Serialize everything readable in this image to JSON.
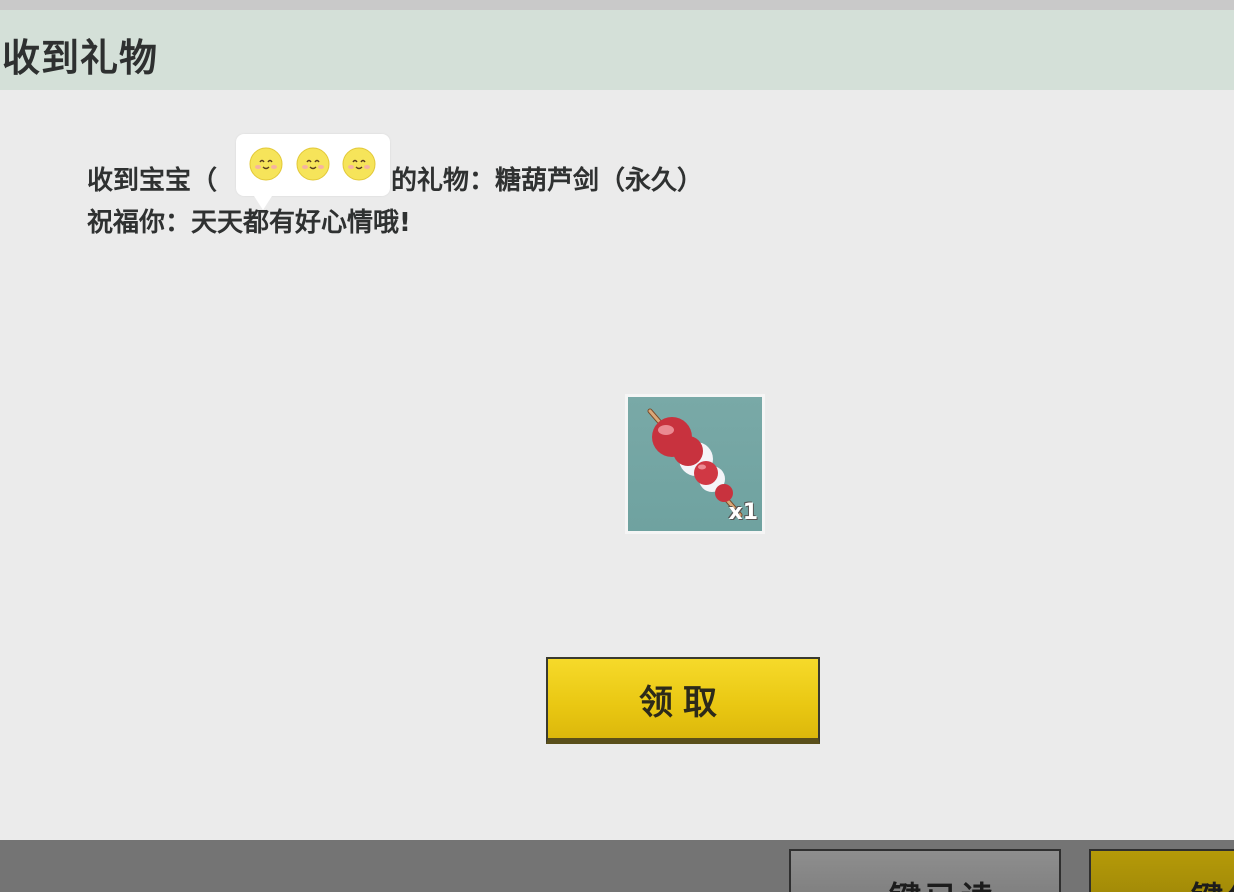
{
  "header": {
    "title": "收到礼物"
  },
  "message": {
    "prefix": "收到宝宝（",
    "sender_emojis": [
      "smiling-chick-emoji",
      "smiling-chick-emoji",
      "smiling-chick-emoji"
    ],
    "suffix": "）的礼物：糖葫芦剑（永久）",
    "blessing": "祝福你：天天都有好心情哦!"
  },
  "gift": {
    "icon": "tanghulu-sword-icon",
    "quantity": "x1"
  },
  "claim_button": {
    "label": "领取"
  },
  "bottom_bar": {
    "mark_all_read_label": "一键已读",
    "claim_all_label": "一键领取"
  },
  "colors": {
    "header_bg": "#d4e0d8",
    "content_bg": "#ebebeb",
    "button_yellow": "#f0cf1a",
    "gift_bg": "#74a6a4",
    "bottom_bar_bg": "#747474"
  }
}
